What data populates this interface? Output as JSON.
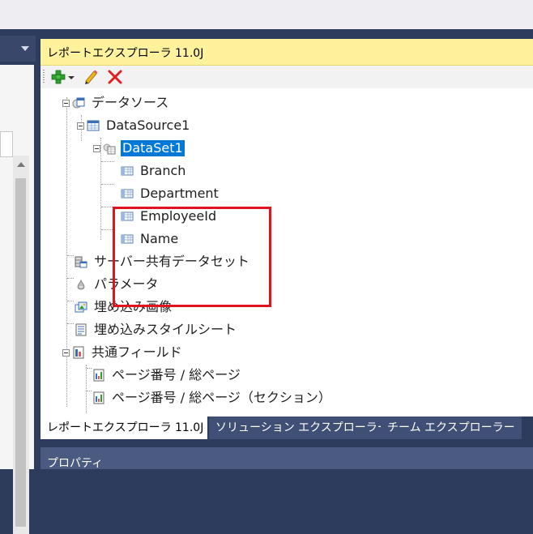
{
  "explorer": {
    "title": "レポートエクスプローラ 11.0J"
  },
  "toolbar": {
    "add_icon": "add-icon",
    "edit_icon": "pencil-icon",
    "delete_icon": "delete-icon"
  },
  "tree": {
    "datasources_label": "データソース",
    "datasource_label": "DataSource1",
    "dataset_label": "DataSet1",
    "fields": [
      "Branch",
      "Department",
      "EmployeeId",
      "Name"
    ],
    "shared_datasets_label": "サーバー共有データセット",
    "parameters_label": "パラメータ",
    "embedded_images_label": "埋め込み画像",
    "embedded_stylesheets_label": "埋め込みスタイルシート",
    "common_fields_label": "共通フィールド",
    "common_fields": [
      "ページ番号 / 総ページ",
      "ページ番号 / 総ページ（セクション）"
    ]
  },
  "tabs": [
    "レポートエクスプローラ 11.0J",
    "ソリューション エクスプローラー",
    "チーム エクスプローラー"
  ],
  "properties": {
    "title": "プロパティ"
  },
  "colors": {
    "title_bar": "#fff29d",
    "selection": "#0078d7",
    "highlight_border": "#e0141e",
    "chrome": "#2d3b5c"
  }
}
